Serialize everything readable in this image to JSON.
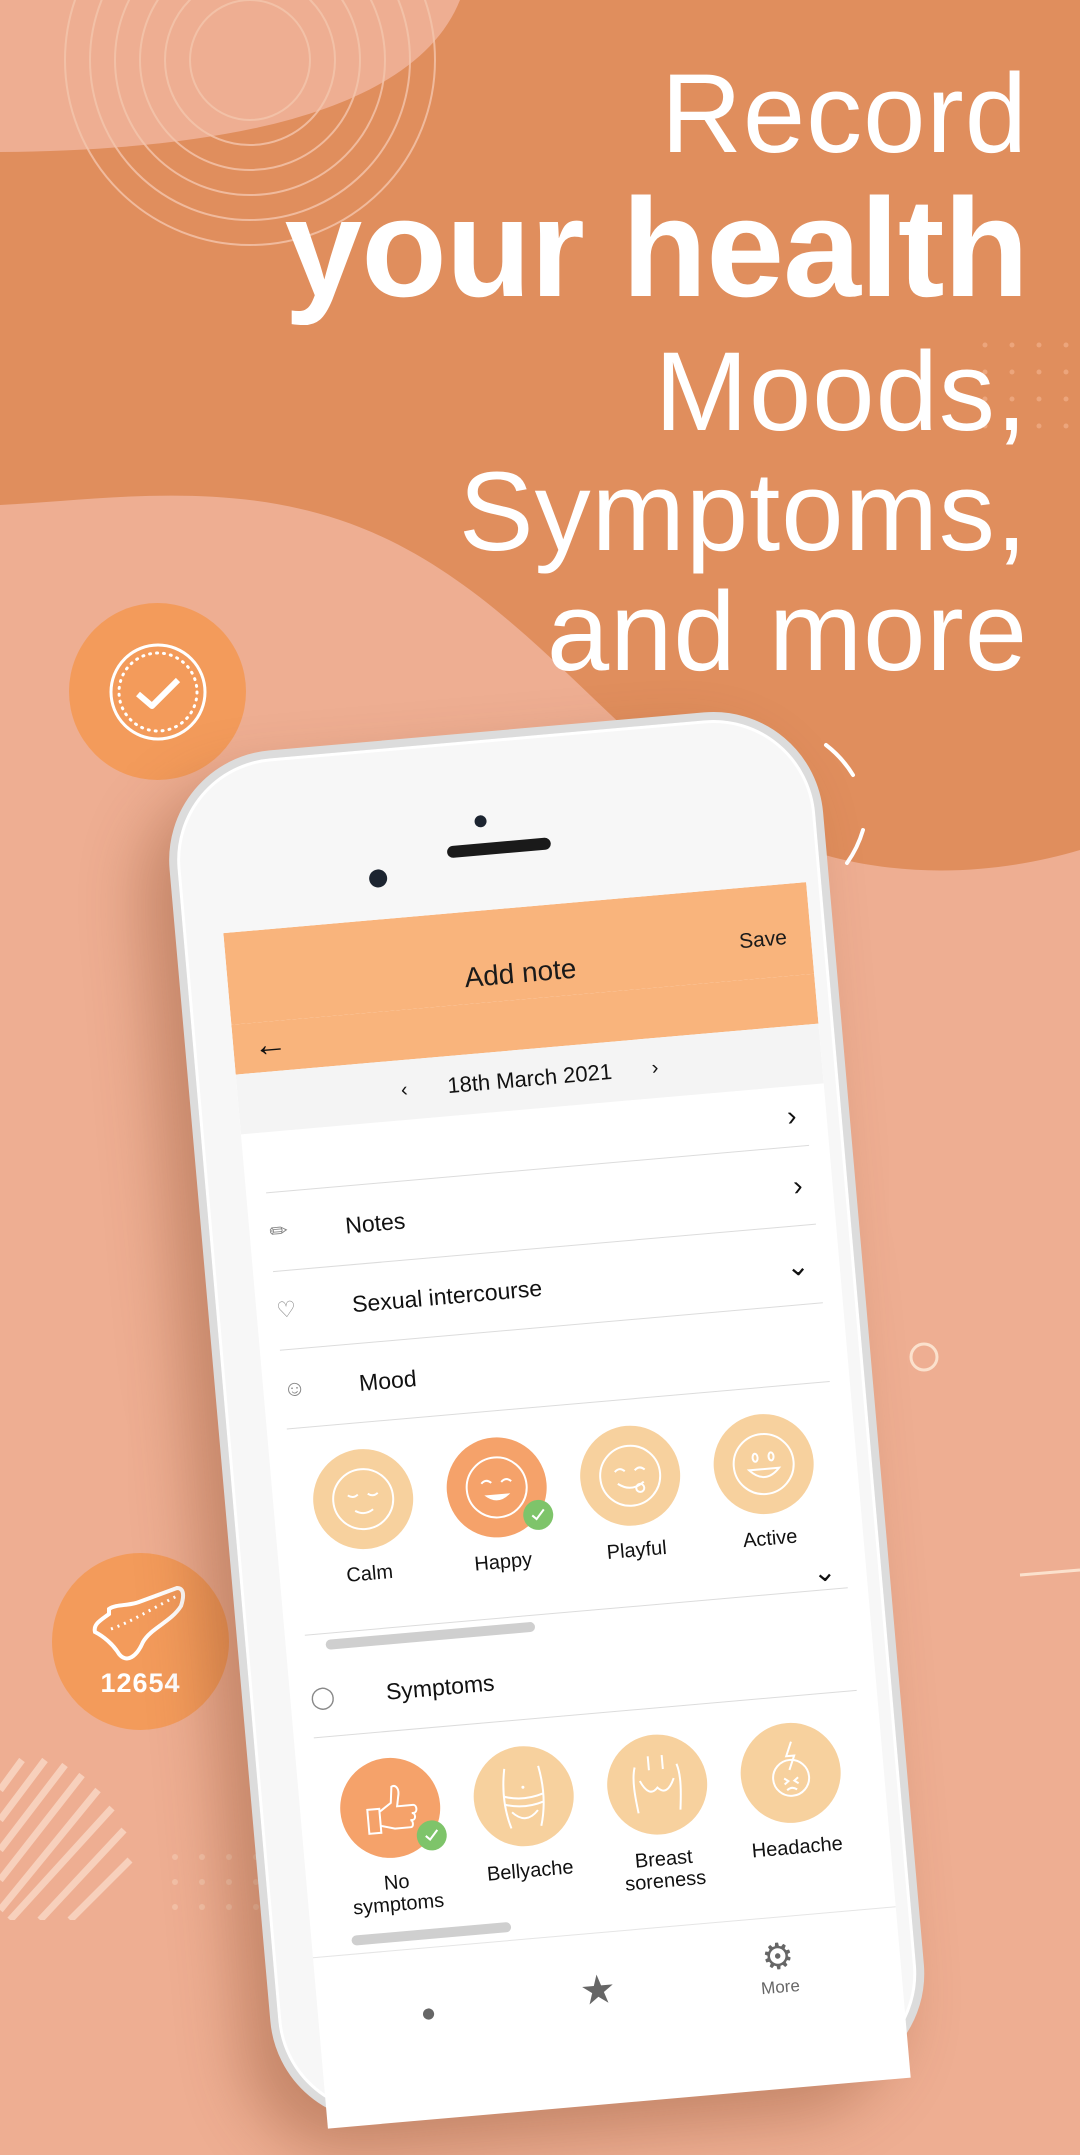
{
  "colors": {
    "background_light": "#eeae92",
    "background_dark": "#e08e5d",
    "badge": "#f39b5b",
    "appbar": "#f9b47c",
    "tile_default": "#f7d19e",
    "tile_selected": "#f5a26a",
    "check_green": "#7ec46a"
  },
  "headline": {
    "line1": "Record",
    "line2": "your health",
    "line3": "Moods,",
    "line4": "Symptoms,",
    "line5": "and more"
  },
  "badges": {
    "check_icon": "check-badge-icon",
    "steps_icon": "shoe-icon",
    "steps_count": "12654"
  },
  "app": {
    "title": "Add note",
    "save_label": "Save",
    "back_icon": "arrow-left-icon",
    "date": "18th March 2021",
    "prev_date": "‹",
    "next_date": "›",
    "rows": [
      {
        "label": "Notes",
        "icon": "pencil-icon",
        "chevron": "›"
      },
      {
        "label": "Sexual intercourse",
        "icon": "heart-icon",
        "chevron": "›"
      },
      {
        "label": "Mood",
        "icon": "smiley-icon",
        "chevron": "⌄"
      }
    ],
    "moods": [
      {
        "label": "Calm",
        "icon": "calm-face-icon",
        "selected": false
      },
      {
        "label": "Happy",
        "icon": "happy-face-icon",
        "selected": true
      },
      {
        "label": "Playful",
        "icon": "playful-face-icon",
        "selected": false
      },
      {
        "label": "Active",
        "icon": "active-face-icon",
        "selected": false
      }
    ],
    "symptoms_section": {
      "label": "Symptoms",
      "icon": "pill-icon",
      "chevron": "⌄"
    },
    "symptoms": [
      {
        "label": "No symptoms",
        "icon": "thumbs-up-icon",
        "selected": true
      },
      {
        "label": "Bellyache",
        "icon": "belly-icon",
        "selected": false
      },
      {
        "label": "Breast soreness",
        "icon": "breast-icon",
        "selected": false
      },
      {
        "label": "Headache",
        "icon": "headache-icon",
        "selected": false
      }
    ],
    "nav": [
      {
        "label": "",
        "icon": "thermometer-icon"
      },
      {
        "label": "",
        "icon": "star-icon"
      },
      {
        "label": "More",
        "icon": "gear-icon"
      }
    ]
  }
}
